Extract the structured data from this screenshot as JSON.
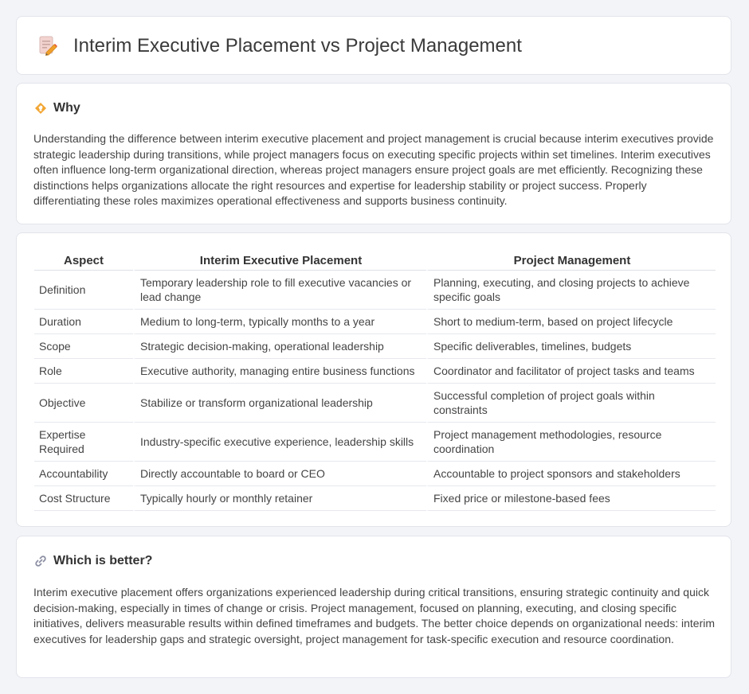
{
  "page": {
    "title": "Interim Executive Placement vs Project Management",
    "icon": "document-edit-icon"
  },
  "why": {
    "icon": "lightbulb-icon",
    "title": "Why",
    "text": "Understanding the difference between interim executive placement and project management is crucial because interim executives provide strategic leadership during transitions, while project managers focus on executing specific projects within set timelines. Interim executives often influence long-term organizational direction, whereas project managers ensure project goals are met efficiently. Recognizing these distinctions helps organizations allocate the right resources and expertise for leadership stability or project success. Properly differentiating these roles maximizes operational effectiveness and supports business continuity."
  },
  "table": {
    "headers": [
      "Aspect",
      "Interim Executive Placement",
      "Project Management"
    ],
    "rows": [
      [
        "Definition",
        "Temporary leadership role to fill executive vacancies or lead change",
        "Planning, executing, and closing projects to achieve specific goals"
      ],
      [
        "Duration",
        "Medium to long-term, typically months to a year",
        "Short to medium-term, based on project lifecycle"
      ],
      [
        "Scope",
        "Strategic decision-making, operational leadership",
        "Specific deliverables, timelines, budgets"
      ],
      [
        "Role",
        "Executive authority, managing entire business functions",
        "Coordinator and facilitator of project tasks and teams"
      ],
      [
        "Objective",
        "Stabilize or transform organizational leadership",
        "Successful completion of project goals within constraints"
      ],
      [
        "Expertise Required",
        "Industry-specific executive experience, leadership skills",
        "Project management methodologies, resource coordination"
      ],
      [
        "Accountability",
        "Directly accountable to board or CEO",
        "Accountable to project sponsors and stakeholders"
      ],
      [
        "Cost Structure",
        "Typically hourly or monthly retainer",
        "Fixed price or milestone-based fees"
      ]
    ]
  },
  "better": {
    "icon": "link-icon",
    "title": "Which is better?",
    "text": "Interim executive placement offers organizations experienced leadership during critical transitions, ensuring strategic continuity and quick decision-making, especially in times of change or crisis. Project management, focused on planning, executing, and closing specific initiatives, delivers measurable results within defined timeframes and budgets. The better choice depends on organizational needs: interim executives for leadership gaps and strategic oversight, project management for task-specific execution and resource coordination."
  }
}
